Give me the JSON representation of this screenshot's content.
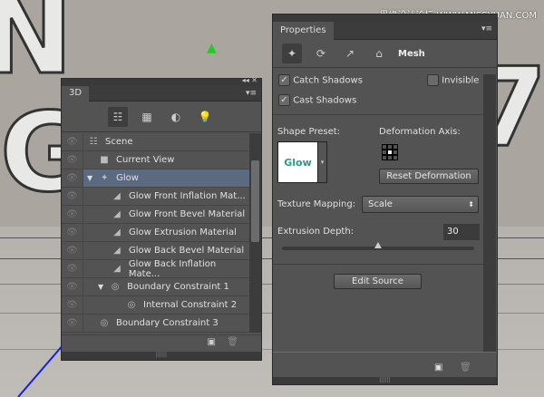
{
  "watermark": "思缘设计论坛 WWW.MISSYUAN.COM",
  "panel3d": {
    "tab": "3D",
    "items": [
      {
        "label": "Scene",
        "icon": "scene-icon",
        "indent": 0,
        "eye": true
      },
      {
        "label": "Current View",
        "icon": "camera-icon",
        "indent": 1,
        "eye": true
      },
      {
        "label": "Glow",
        "icon": "mesh-icon",
        "indent": 0,
        "eye": true,
        "selected": true,
        "expanded": true
      },
      {
        "label": "Glow Front Inflation Mat...",
        "icon": "material-icon",
        "indent": 2,
        "eye": true
      },
      {
        "label": "Glow Front Bevel Material",
        "icon": "material-icon",
        "indent": 2,
        "eye": true
      },
      {
        "label": "Glow Extrusion Material",
        "icon": "material-icon",
        "indent": 2,
        "eye": true
      },
      {
        "label": "Glow Back Bevel Material",
        "icon": "material-icon",
        "indent": 2,
        "eye": true
      },
      {
        "label": "Glow Back Inflation Mate...",
        "icon": "material-icon",
        "indent": 2,
        "eye": true
      },
      {
        "label": "Boundary Constraint 1",
        "icon": "constraint-icon",
        "indent": 1,
        "eye": true,
        "expanded": true
      },
      {
        "label": "Internal Constraint 2",
        "icon": "constraint-icon",
        "indent": 3,
        "eye": true
      },
      {
        "label": "Boundary Constraint 3",
        "icon": "constraint-icon",
        "indent": 1,
        "eye": true
      }
    ]
  },
  "properties": {
    "tab": "Properties",
    "section": "Mesh",
    "catch_shadows": "Catch Shadows",
    "cast_shadows": "Cast Shadows",
    "invisible": "Invisible",
    "shape_preset": "Shape Preset:",
    "preset_text": "Glow",
    "deformation_axis": "Deformation Axis:",
    "reset_deformation": "Reset Deformation",
    "texture_mapping": "Texture Mapping:",
    "texture_value": "Scale",
    "extrusion_depth": "Extrusion Depth:",
    "extrusion_value": "30",
    "extrusion_fraction": 0.5,
    "edit_source": "Edit Source"
  }
}
